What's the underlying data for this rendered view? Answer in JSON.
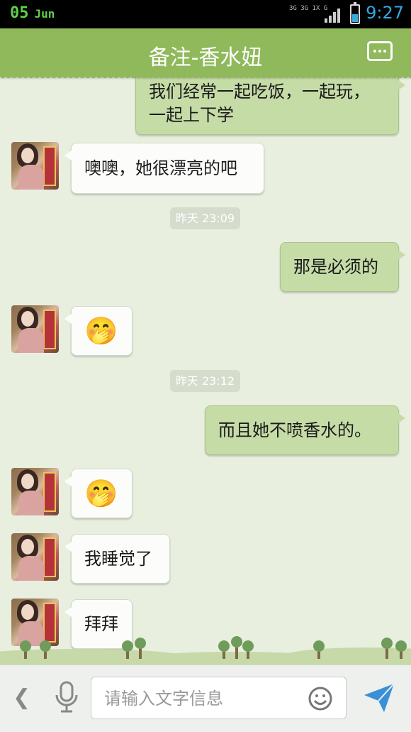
{
  "status_bar": {
    "date_day": "05",
    "date_month": "Jun",
    "network": "3G 3G 1X G",
    "time": "9:27"
  },
  "header": {
    "title": "备注-香水妞"
  },
  "messages": {
    "m1": "我们经常一起吃饭，一起玩，一起上下学",
    "m2": "噢噢，她很漂亮的吧",
    "t1": "昨天 23:09",
    "m3": "那是必须的",
    "m4": "🤭",
    "t2": "昨天 23:12",
    "m5": "而且她不喷香水的。",
    "m6": "🤭",
    "m7": "我睡觉了",
    "m8": "拜拜"
  },
  "input": {
    "placeholder": "请输入文字信息",
    "value": ""
  },
  "icons": {
    "back": "chevron-left-icon",
    "voice": "microphone-icon",
    "emoji": "smiley-icon",
    "send": "send-icon",
    "more": "more-icon"
  },
  "colors": {
    "header": "#8fb95b",
    "outgoing_bubble": "#c6dca7",
    "incoming_bubble": "#fcfdfb",
    "background": "#e8efdf",
    "time_accent": "#35a9e0"
  }
}
